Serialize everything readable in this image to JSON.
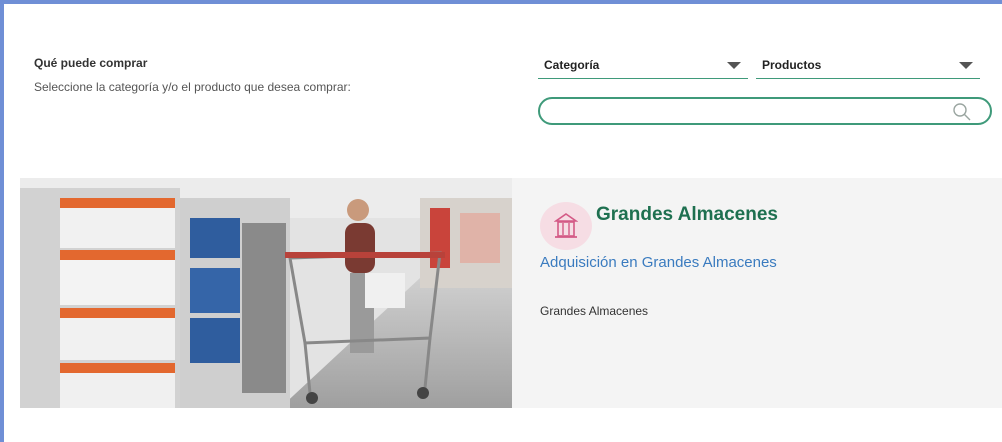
{
  "header": {
    "title": "Qué puede comprar",
    "subtitle": "Seleccione la categoría y/o el producto que desea comprar:"
  },
  "filters": {
    "category": {
      "value": "Categoría"
    },
    "products": {
      "value": "Productos"
    }
  },
  "search": {
    "value": "",
    "placeholder": ""
  },
  "card": {
    "title": "Grandes Almacenes",
    "link": "Adquisición en Grandes Almacenes",
    "description": "Grandes Almacenes",
    "icon": "department-store-icon",
    "image": "shopper-with-cart-in-store-aisle"
  },
  "colors": {
    "accent": "#3f9a7a",
    "title_green": "#1e7050",
    "link_blue": "#3a7bbf",
    "icon_bg": "#f6dde4",
    "icon_fg": "#d45a86",
    "card_bg": "#f4f4f4",
    "frame": "#6f8fd6"
  }
}
